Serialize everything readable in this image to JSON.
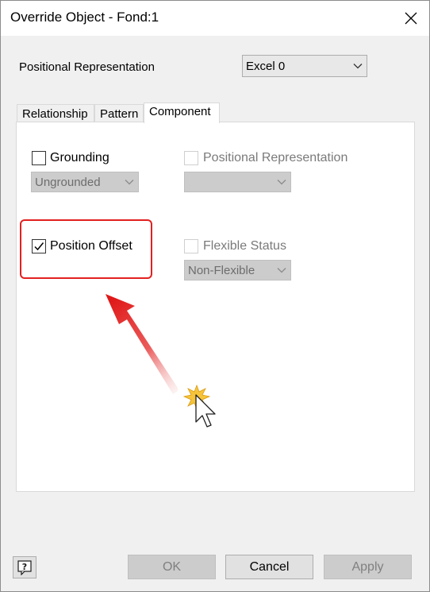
{
  "window": {
    "title": "Override Object - Fond:1"
  },
  "positional": {
    "label": "Positional Representation",
    "selected": "Excel 0"
  },
  "tabs": [
    {
      "label": "Relationship"
    },
    {
      "label": "Pattern"
    },
    {
      "label": "Component"
    }
  ],
  "component": {
    "grounding": {
      "label": "Grounding",
      "checked": false,
      "dropdown": "Ungrounded"
    },
    "positional_rep": {
      "label": "Positional Representation",
      "checked": false,
      "dropdown": ""
    },
    "position_offset": {
      "label": "Position Offset",
      "checked": true
    },
    "flexible_status": {
      "label": "Flexible Status",
      "checked": false,
      "dropdown": "Non-Flexible"
    }
  },
  "buttons": {
    "ok": "OK",
    "cancel": "Cancel",
    "apply": "Apply"
  },
  "icons": {
    "close": "close-icon",
    "help": "help-icon",
    "annotation_arrow": "red-arrow-icon",
    "cursor": "mouse-pointer-click-icon"
  },
  "colors": {
    "annotation": "#e32020",
    "panel": "#ffffff",
    "dialog_bg": "#f0f0f0"
  }
}
